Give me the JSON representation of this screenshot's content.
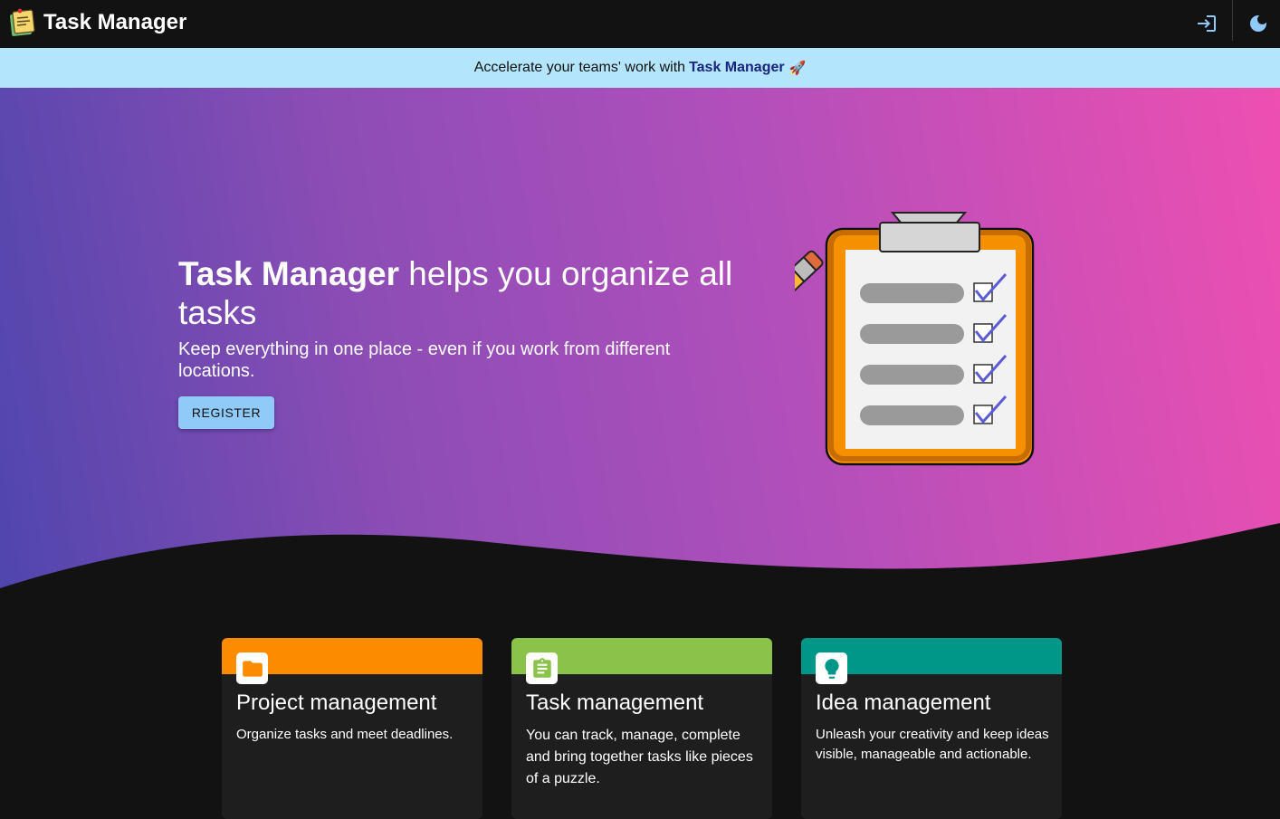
{
  "app": {
    "title": "Task Manager"
  },
  "banner": {
    "prefix": "Accelerate your teams' work with",
    "link": "Task Manager",
    "emoji": "🚀"
  },
  "hero": {
    "title_bold": "Task Manager",
    "title_rest": " helps you organize all tasks",
    "subtitle": "Keep everything in one place - even if you work from different locations.",
    "register_label": "REGISTER"
  },
  "icons": {
    "logo": "sticky-note-logo",
    "login": "login-icon",
    "theme": "dark-mode-icon",
    "hero": "clipboard-checklist-illustration"
  },
  "cards": [
    {
      "title": "Project management",
      "text": "Organize tasks and meet deadlines.",
      "color": "#fb8c00",
      "icon": "folder-icon"
    },
    {
      "title": "Task management",
      "text": "You can track, manage, complete and bring together tasks like pieces of a puzzle.",
      "color": "#8bc34a",
      "icon": "assignment-icon"
    },
    {
      "title": "Idea management",
      "text": "Unleash your creativity and keep ideas visible, manageable and actionable.",
      "color": "#009688",
      "icon": "lightbulb-icon"
    }
  ],
  "colors": {
    "banner": "#b3e5fc",
    "accent": "#90caf9",
    "background": "#121212"
  }
}
